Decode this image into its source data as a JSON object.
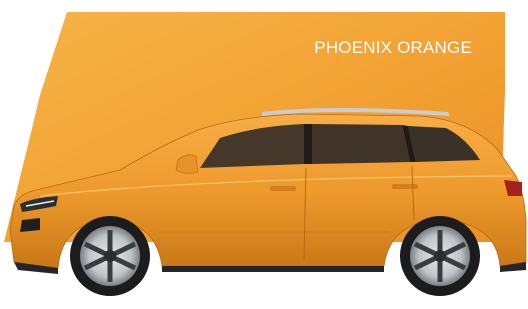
{
  "swatch": {
    "name": "PHOENIX ORANGE",
    "color": "#f2a132",
    "highlight_color": "#f7b851",
    "label_color": "#ffffff"
  },
  "car": {
    "body_color": "#ee9a2c",
    "window_color": "#3f3328",
    "tire_color": "#1c1c1e",
    "rim_color": "#cfd3d6"
  }
}
